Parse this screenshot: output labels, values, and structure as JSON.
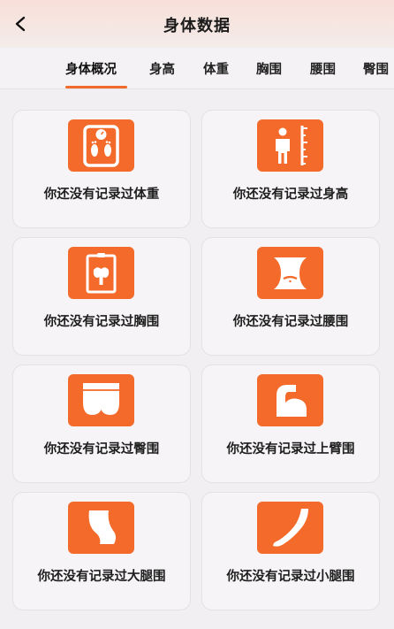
{
  "header": {
    "title": "身体数据",
    "back_icon": "chevron-left-icon"
  },
  "tabs": [
    {
      "label": "身体概况",
      "active": true
    },
    {
      "label": "身高",
      "active": false
    },
    {
      "label": "体重",
      "active": false
    },
    {
      "label": "胸围",
      "active": false
    },
    {
      "label": "腰围",
      "active": false
    },
    {
      "label": "臀围",
      "active": false
    }
  ],
  "colors": {
    "accent": "#f36a2a",
    "background": "#f1eff1",
    "card": "#f6f4f6"
  },
  "cards": [
    {
      "label": "你还没有记录过体重",
      "icon": "scale-icon"
    },
    {
      "label": "你还没有记录过身高",
      "icon": "height-icon"
    },
    {
      "label": "你还没有记录过胸围",
      "icon": "chest-icon"
    },
    {
      "label": "你还没有记录过腰围",
      "icon": "waist-icon"
    },
    {
      "label": "你还没有记录过臀围",
      "icon": "hip-icon"
    },
    {
      "label": "你还没有记录过上臂围",
      "icon": "upper-arm-icon"
    },
    {
      "label": "你还没有记录过大腿围",
      "icon": "thigh-icon"
    },
    {
      "label": "你还没有记录过小腿围",
      "icon": "calf-icon"
    }
  ]
}
